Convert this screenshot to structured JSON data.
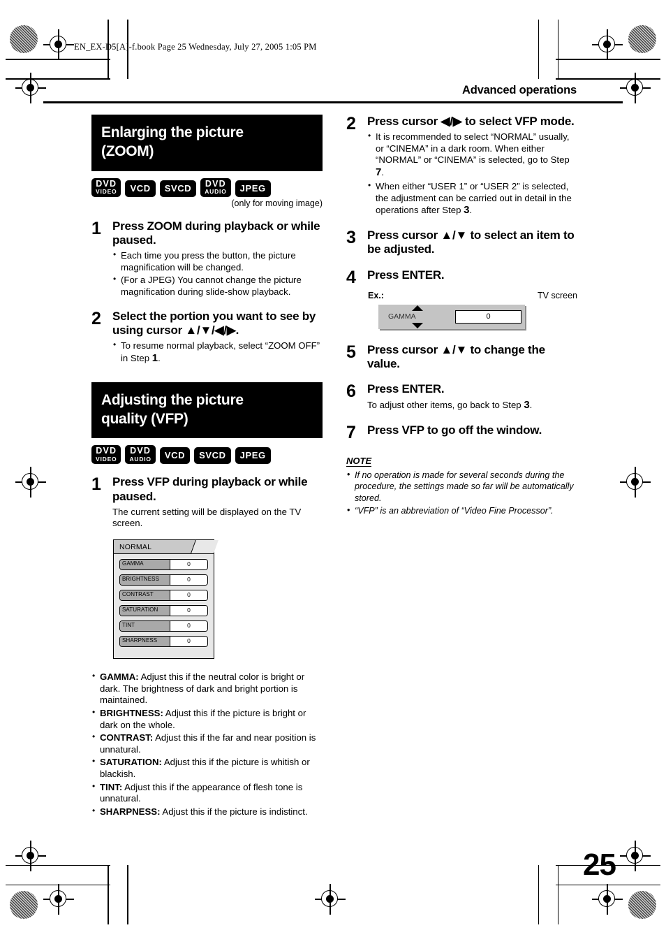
{
  "print_marks": {
    "book_line": "EN_EX-D5[A]-f.book  Page 25  Wednesday, July 27, 2005  1:05 PM"
  },
  "header": {
    "running_head": "Advanced operations"
  },
  "left_column": {
    "section": {
      "title_line1": "Enlarging the picture",
      "title_line2": "(ZOOM)",
      "badges": [
        {
          "line1": "DVD",
          "line2": "VIDEO"
        },
        {
          "line1": "VCD",
          "line2": ""
        },
        {
          "line1": "SVCD",
          "line2": ""
        },
        {
          "line1": "DVD",
          "line2": "AUDIO"
        },
        {
          "line1": "JPEG",
          "line2": ""
        }
      ],
      "badge_note": "(only for moving image)"
    },
    "steps": [
      {
        "num": "1",
        "title": "Press ZOOM during playback or while paused.",
        "bullets": [
          "Each time you press the button, the picture magnification will be changed.",
          "(For a JPEG) You cannot change the picture magnification during slide-show playback."
        ]
      },
      {
        "num": "2",
        "title": "Select the portion you want to see by using cursor ▲/▼/◀/▶.",
        "bullets_rich": [
          {
            "pre": "To resume normal playback, select “ZOOM OFF” in Step ",
            "num": "1",
            "post": "."
          }
        ]
      }
    ],
    "section2": {
      "title_line1": "Adjusting the picture",
      "title_line2": "quality (VFP)",
      "badges": [
        {
          "line1": "DVD",
          "line2": "VIDEO"
        },
        {
          "line1": "DVD",
          "line2": "AUDIO"
        },
        {
          "line1": "VCD",
          "line2": ""
        },
        {
          "line1": "SVCD",
          "line2": ""
        },
        {
          "line1": "JPEG",
          "line2": ""
        }
      ]
    },
    "step_vfp1": {
      "num": "1",
      "title": "Press VFP during playback or while paused.",
      "sub": "The current setting will be displayed on the TV screen."
    },
    "osd": {
      "tab_label": "NORMAL",
      "rows": [
        {
          "label": "GAMMA",
          "value": "0"
        },
        {
          "label": "BRIGHTNESS",
          "value": "0"
        },
        {
          "label": "CONTRAST",
          "value": "0"
        },
        {
          "label": "SATURATION",
          "value": "0"
        },
        {
          "label": "TINT",
          "value": "0"
        },
        {
          "label": "SHARPNESS",
          "value": "0"
        }
      ]
    },
    "descriptions": [
      {
        "term": "GAMMA:",
        "text": " Adjust this if the neutral color is bright or dark. The brightness of dark and bright portion is maintained."
      },
      {
        "term": "BRIGHTNESS:",
        "text": " Adjust this if the picture is bright or dark on the whole."
      },
      {
        "term": "CONTRAST:",
        "text": " Adjust this if the far and near position is unnatural."
      },
      {
        "term": "SATURATION:",
        "text": " Adjust this if the picture is whitish or blackish."
      },
      {
        "term": "TINT:",
        "text": " Adjust this if the appearance of flesh tone is unnatural."
      },
      {
        "term": "SHARPNESS:",
        "text": " Adjust this if the picture is indistinct."
      }
    ]
  },
  "right_column": {
    "step2": {
      "num": "2",
      "title": "Press cursor ◀/▶ to select VFP mode.",
      "bullet1": {
        "pre": "It is recommended to select “NORMAL” usually, or “CINEMA” in a dark room. When either “NORMAL” or “CINEMA” is selected, go to Step ",
        "num": "7",
        "post": "."
      },
      "bullet2": {
        "pre": "When either “USER 1” or “USER 2” is selected, the adjustment can be carried out in detail in the operations after Step ",
        "num": "3",
        "post": "."
      }
    },
    "step3": {
      "num": "3",
      "title": "Press cursor ▲/▼ to select an item to be adjusted."
    },
    "step4": {
      "num": "4",
      "title": "Press ENTER."
    },
    "example": {
      "label": "Ex.:",
      "tv_caption": "TV screen",
      "item_name": "GAMMA",
      "item_value": "0"
    },
    "step5": {
      "num": "5",
      "title": "Press cursor ▲/▼ to change the value."
    },
    "step6": {
      "num": "6",
      "title": "Press ENTER.",
      "sub_pre": "To adjust other items, go back to Step ",
      "sub_num": "3",
      "sub_post": "."
    },
    "step7": {
      "num": "7",
      "title": "Press VFP to go off the window."
    },
    "note": {
      "heading": "NOTE",
      "items": [
        "If no operation is made for several seconds during the procedure, the settings made so far will be automatically stored.",
        "“VFP” is an abbreviation of “Video Fine Processor”."
      ]
    }
  },
  "folio": {
    "page_number": "25"
  }
}
